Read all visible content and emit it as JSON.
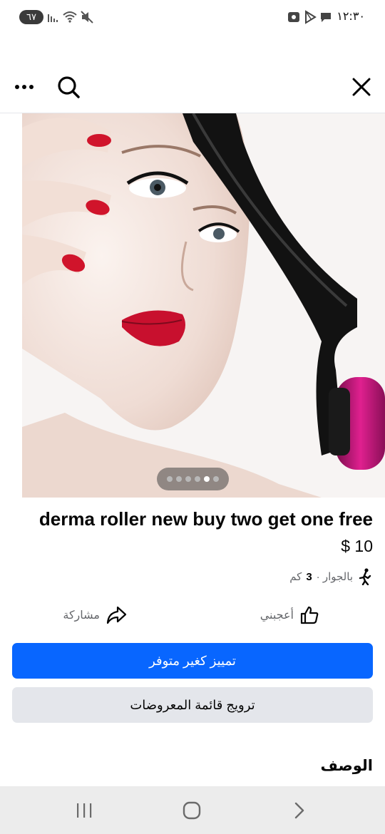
{
  "status_bar": {
    "time": "١٢:٣٠",
    "battery": "٦٧",
    "icons": [
      "photo-notification-icon",
      "play-store-icon",
      "message-icon",
      "signal-icon",
      "wifi-icon",
      "mute-icon"
    ]
  },
  "toolbar": {
    "icons": [
      "more-icon",
      "search-icon",
      "close-icon"
    ]
  },
  "gallery": {
    "image": "woman-with-derma-roller",
    "page_count": 6,
    "current_page": 5
  },
  "listing": {
    "title": "derma roller new buy two get one free",
    "price": "$ 10",
    "location_prefix": "بالجوار ·",
    "distance": "3",
    "distance_unit": "كم"
  },
  "actions": {
    "like": "أعجبني",
    "share": "مشاركة"
  },
  "buttons": {
    "mark_unavailable": "تمييز كغير متوفر",
    "boost_listing": "ترويج قائمة المعروضات"
  },
  "description": {
    "heading": "الوصف"
  },
  "colors": {
    "primary": "#0866ff",
    "secondary_button": "#e4e6eb",
    "muted_text": "#65676b"
  }
}
